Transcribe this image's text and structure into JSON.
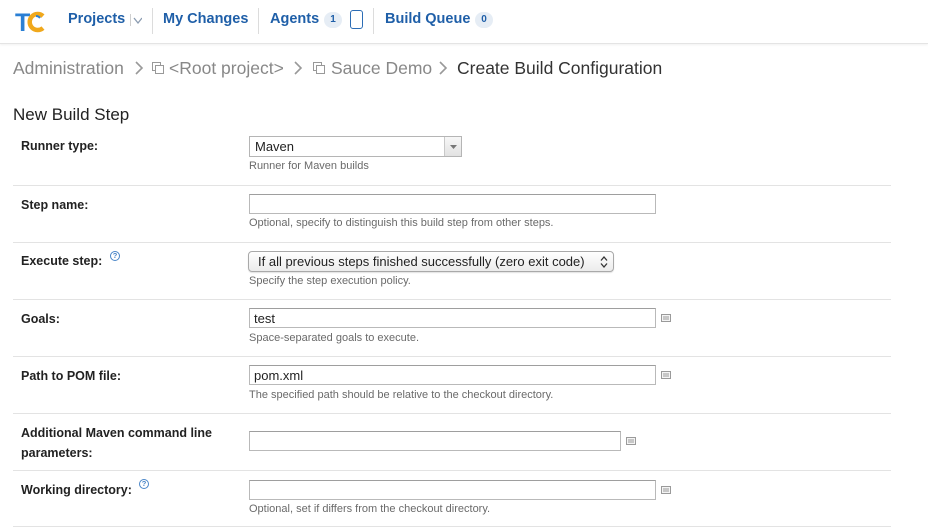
{
  "nav": {
    "logo_text": "TC",
    "projects": "Projects",
    "my_changes": "My Changes",
    "agents": "Agents",
    "agents_count": "1",
    "build_queue": "Build Queue",
    "build_queue_count": "0"
  },
  "breadcrumb": {
    "items": [
      "Administration",
      "<Root project>",
      "Sauce Demo",
      "Create Build Configuration"
    ]
  },
  "section_title": "New Build Step",
  "form": {
    "runner_type": {
      "label": "Runner type:",
      "value": "Maven",
      "note": "Runner for Maven builds"
    },
    "step_name": {
      "label": "Step name:",
      "value": "",
      "note": "Optional, specify to distinguish this build step from other steps."
    },
    "execute_step": {
      "label": "Execute step:",
      "value": "If all previous steps finished successfully (zero exit code)",
      "note": "Specify the step execution policy."
    },
    "goals": {
      "label": "Goals:",
      "value": "test",
      "note": "Space-separated goals to execute."
    },
    "pom_path": {
      "label": "Path to POM file:",
      "value": "pom.xml",
      "note": "The specified path should be relative to the checkout directory."
    },
    "maven_params": {
      "label_line1": "Additional Maven command line",
      "label_line2": "parameters:",
      "value": ""
    },
    "working_dir": {
      "label": "Working directory:",
      "value": "",
      "note": "Optional, set if differs from the checkout directory."
    }
  },
  "colors": {
    "nav_link": "#1f5fa8",
    "logo_blue": "#2a7fd4",
    "logo_orange": "#f0a81c",
    "help_icon": "#4a86c8"
  },
  "icons": {
    "logo": "teamcity-logo",
    "projects_dropdown": "chevron-down-icon",
    "agents": "agent-device-icon",
    "breadcrumb_separator": "chevron-right-icon",
    "project_icon": "project-icon",
    "help": "help-icon",
    "expand": "expand-field-icon"
  }
}
